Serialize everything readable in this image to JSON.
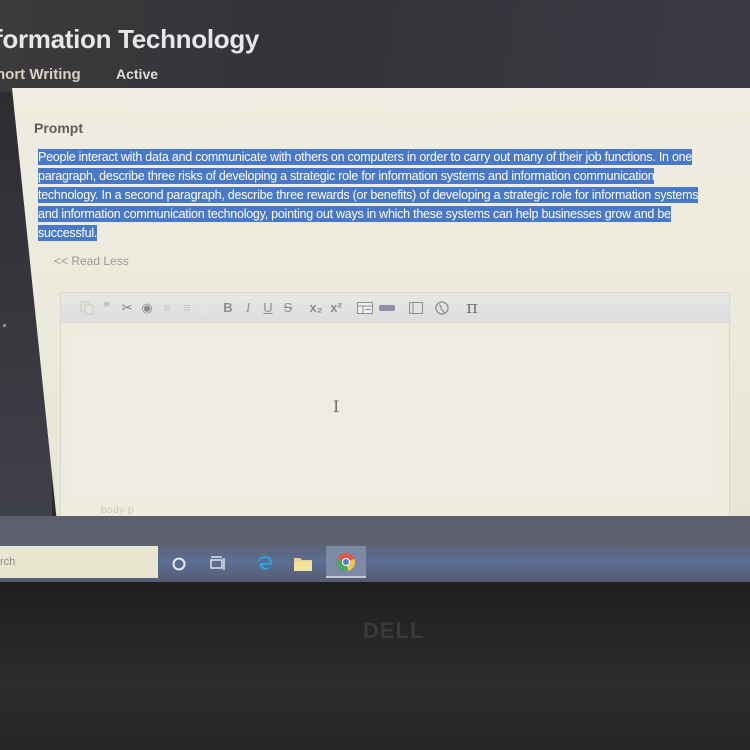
{
  "header": {
    "course_title": "Information Technology",
    "course_title_visible": "formation Technology",
    "activity_type": "Short Writing",
    "activity_type_visible": "hort Writing",
    "status": "Active"
  },
  "prompt": {
    "label": "Prompt",
    "lines": [
      "People interact with data and communicate with others on computers in order to carry out many of their job functions. In one",
      "paragraph, describe three risks of developing a strategic role for information systems and information communication",
      "technology. In a second paragraph, describe three rewards (or benefits) of developing a strategic role for information systems",
      "and information communication technology, pointing out ways in which these systems can help businesses grow and be",
      "successful."
    ],
    "selection_color": "#4a78c9",
    "read_less_link": "<< Read Less"
  },
  "editor": {
    "toolbar": {
      "paste": "paste-icon",
      "blockquote": "❞",
      "cut": "✂",
      "record": "◉",
      "align_left": "≡",
      "align_center": "≡",
      "bold": "B",
      "italic": "I",
      "underline": "U",
      "strikethrough": "S",
      "subscript": "x₂",
      "superscript": "x²",
      "table": "table-icon",
      "horizontal_rule": "hr-icon",
      "special_box": "box-icon",
      "link": "globe-icon",
      "math": "π"
    },
    "content": "",
    "status_path": "body  p"
  },
  "taskbar": {
    "search_text": "rch",
    "apps": [
      "cortana",
      "task-view",
      "edge",
      "file-explorer",
      "chrome"
    ],
    "active_app": "chrome"
  },
  "bezel": {
    "brand": "DELL"
  }
}
